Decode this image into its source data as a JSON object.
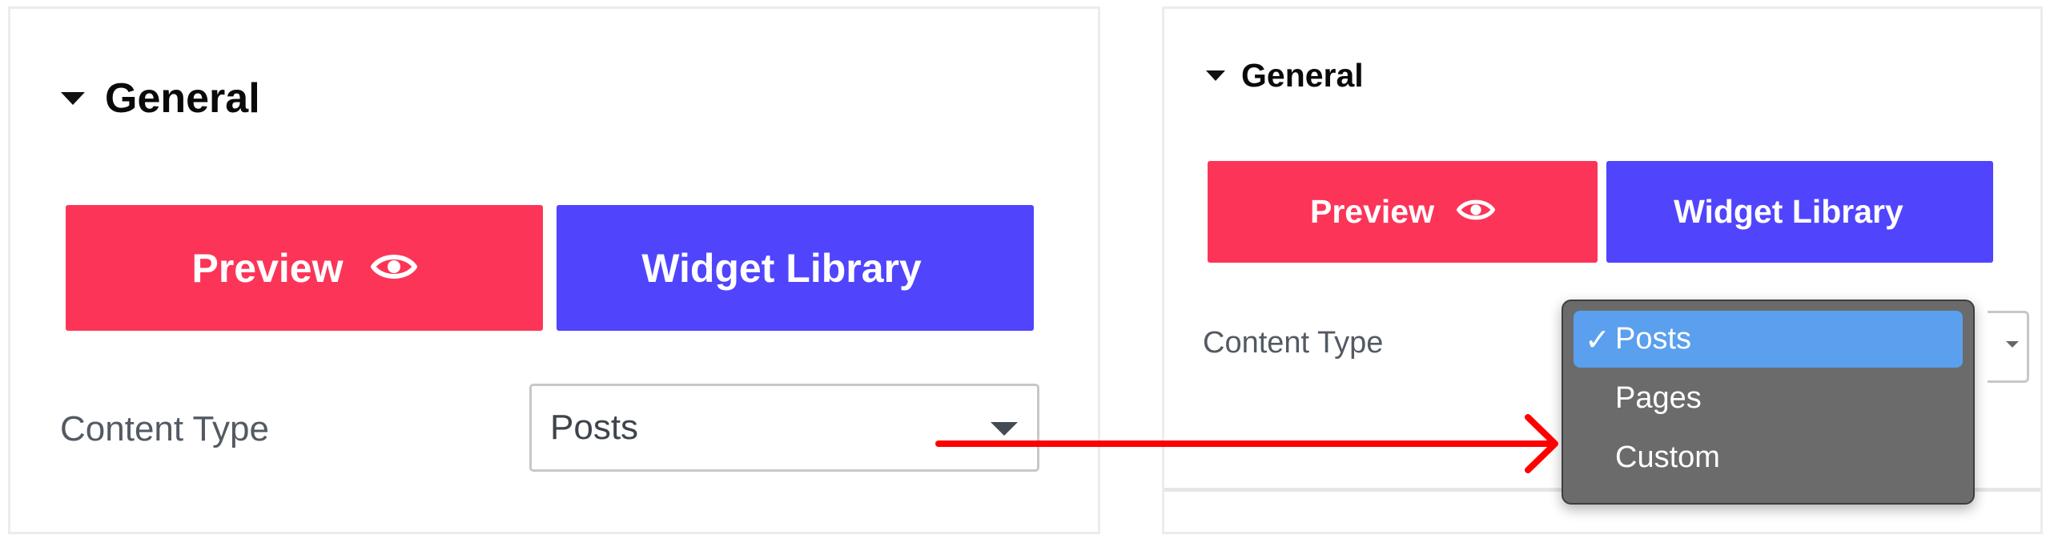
{
  "left_panel": {
    "section_title": "General",
    "preview_label": "Preview",
    "library_label": "Widget Library",
    "content_type_label": "Content Type",
    "selected_value": "Posts"
  },
  "right_panel": {
    "section_title": "General",
    "preview_label": "Preview",
    "library_label": "Widget Library",
    "content_type_label": "Content Type"
  },
  "dropdown": {
    "options": [
      {
        "label": "Posts",
        "selected": true,
        "check": "✓"
      },
      {
        "label": "Pages",
        "selected": false,
        "check": ""
      },
      {
        "label": "Custom",
        "selected": false,
        "check": ""
      }
    ]
  },
  "icons": {
    "section_caret": "caret-down-icon",
    "preview": "eye-icon",
    "library": "grid-icon",
    "select": "chevron-down-icon",
    "annotation": "arrow-right-icon"
  },
  "colors": {
    "preview_button": "#fc3558",
    "library_button": "#5045fc",
    "dropdown_background": "#6b6b6b",
    "dropdown_selected": "#5aa0ee",
    "arrow": "#ff0000"
  }
}
